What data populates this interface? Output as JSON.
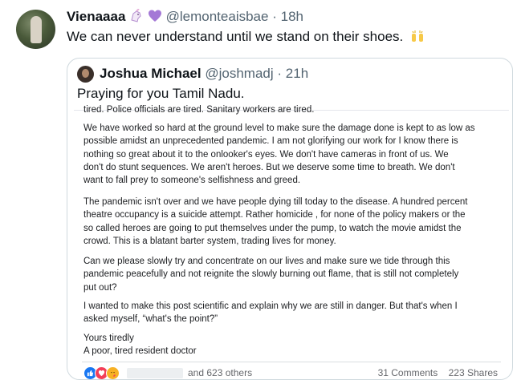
{
  "tweet": {
    "display_name": "Vienaaaa",
    "name_emojis": [
      "unicorn-emoji",
      "purple-heart-emoji"
    ],
    "handle": "@lemonteaisbae",
    "separator": "·",
    "time": "18h",
    "text": "We can never understand until we stand  on their shoes."
  },
  "quoted_tweet": {
    "display_name": "Joshua Michael",
    "handle": "@joshmadj",
    "separator": "·",
    "time": "21h",
    "text": "Praying for you Tamil Nadu.",
    "fb_post": {
      "cut_line": "tired. Police officials are tired. Sanitary workers are tired.",
      "paragraphs": [
        {
          "lines": [
            "We have worked so hard at the ground level to make sure the damage done is kept to as low as",
            "possible amidst an unprecedented pandemic. I am not glorifying our work for I know there is",
            "nothing so great about it to the onlooker's eyes. We don't have cameras in front of us. We",
            "don't do stunt sequences. We aren't heroes. But we deserve some time to breath. We don't",
            "want to fall prey to someone's selfishness and greed."
          ]
        },
        {
          "lines": [
            "The pandemic isn't over and we have people dying till today to the disease. A hundred percent",
            "theatre occupancy is a suicide attempt. Rather homicide , for none of the policy makers or the",
            "so called heroes are going to put themselves under the pump, to watch the movie amidst the",
            "crowd. This is a blatant barter system, trading lives for money."
          ]
        },
        {
          "lines": [
            "Can we please slowly try and concentrate on our lives and make sure we tide through this",
            "pandemic peacefully and not reignite the slowly burning out flame, that is still not completely",
            "put out?"
          ]
        },
        {
          "lines": [
            "I wanted to make this post scientific and explain why we are still in danger. But that's when I",
            "asked myself, “what's the point?”"
          ]
        },
        {
          "lines": [
            "Yours tiredly",
            "A poor, tired resident doctor"
          ]
        }
      ],
      "reactions_text": "and 623 others",
      "comments": "31 Comments",
      "shares": "223 Shares",
      "reaction_icons": [
        "like-icon",
        "love-icon",
        "care-icon"
      ]
    }
  }
}
